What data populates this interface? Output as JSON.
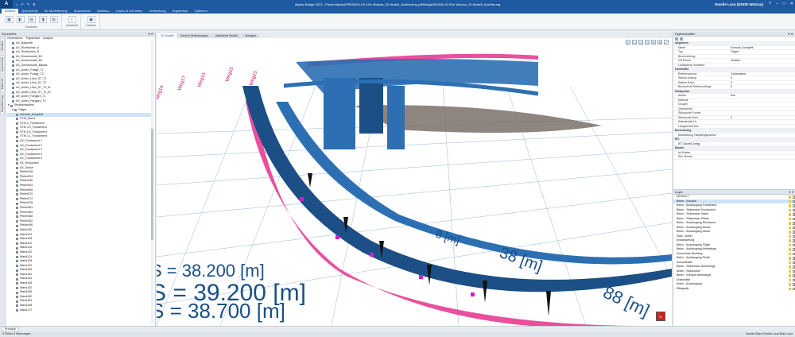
{
  "titlebar": {
    "logo": "A",
    "quick_access": [
      "⌂",
      "↶",
      "↷",
      "⚙"
    ],
    "title": "Allplan Bridge 2022 - Planer/Allplan\\PR0002\\6.U3 KDe Wutzau_20 Modell_Ausführung.ydf\\Bridge\\0002\\6.U3 KDe Wutzau_20 Modell_Ausführung",
    "user": "Davide Luca (DKDE-Wutzau)",
    "controls": [
      "?",
      "–",
      "□",
      "✕"
    ]
  },
  "menu_tabs": [
    "Ansicht",
    "Querschnitt",
    "3D Modellierung",
    "Spannkabel",
    "Stahlbau",
    "Lasten & Einheiten",
    "Verstärkung",
    "Ergebnisse",
    "Optionen"
  ],
  "ribbon": {
    "groups": [
      {
        "label": "Darstellen",
        "buttons": [
          {
            "icon": "▦",
            "label": ""
          },
          {
            "icon": "◧",
            "label": ""
          },
          {
            "icon": "▤",
            "label": ""
          },
          {
            "icon": "◨",
            "label": ""
          },
          {
            "icon": "▧",
            "label": ""
          }
        ]
      },
      {
        "label": "",
        "buttons": [
          {
            "icon": "⇪",
            "label": "Quadrant"
          }
        ]
      },
      {
        "label": "",
        "buttons": [
          {
            "icon": "▣",
            "label": "Löschen"
          }
        ]
      }
    ]
  },
  "left_panel": {
    "title": "Geometrie",
    "tabs": [
      "Generatoren",
      "Ergebnisse",
      "Analyse"
    ],
    "vertical_tabs": [
      "Bauteile",
      "Querschnitt",
      "Materiale",
      "Kabelführung"
    ],
    "tree": [
      {
        "label": "AX_Bauprofil",
        "indent": 1
      },
      {
        "label": "AX_Richtachse_A",
        "indent": 1
      },
      {
        "label": "AX_Richtachse_B",
        "indent": 1
      },
      {
        "label": "AX_Deckenstufe_B1",
        "indent": 1
      },
      {
        "label": "AX_Deckenstufe_B2",
        "indent": 1
      },
      {
        "label": "AX_Deckenstufe_Ballast",
        "indent": 1
      },
      {
        "label": "AX_Anker_Fräsgr_T1",
        "indent": 1
      },
      {
        "label": "AX_Anker_Fräsgr_T2",
        "indent": 1
      },
      {
        "label": "AX_Anker_Litze_S7_T1",
        "indent": 1
      },
      {
        "label": "AX_Anker_Litze_S7_T2",
        "indent": 1
      },
      {
        "label": "AX_Anker_Litze_S7_T1_M",
        "indent": 1
      },
      {
        "label": "AX_Anker_Litze_S7_T2_M",
        "indent": 1
      },
      {
        "label": "AX_Anker_Fangarn_T1",
        "indent": 1
      },
      {
        "label": "AX_Anker_Fangarn_T2",
        "indent": 1
      },
      {
        "label": "Strukturbauteile",
        "indent": 0,
        "expand": "▾"
      },
      {
        "label": "Träger",
        "indent": 1,
        "expand": "▾"
      },
      {
        "label": "Konsole_Komplett",
        "indent": 2,
        "selected": true
      },
      {
        "label": "STM_Wand",
        "indent": 2
      },
      {
        "label": "STM 4_Fundament",
        "indent": 2
      },
      {
        "label": "STM 3.3_Fundament",
        "indent": 2
      },
      {
        "label": "STM 3.5_Fundament",
        "indent": 2
      },
      {
        "label": "STM 3.1_Fundament",
        "indent": 2
      },
      {
        "label": "AX_Fundament 1",
        "indent": 2
      },
      {
        "label": "AX_Fundament 2",
        "indent": 2
      },
      {
        "label": "AX_Fundament 3",
        "indent": 2
      },
      {
        "label": "AX_Fundament 4",
        "indent": 2
      },
      {
        "label": "AX_Fundament 5",
        "indent": 2
      },
      {
        "label": "AX_Rückwand",
        "indent": 2
      },
      {
        "label": "AX_Decke",
        "indent": 2
      },
      {
        "label": "Pfeiler018",
        "indent": 2
      },
      {
        "label": "Pfeiler033",
        "indent": 2
      },
      {
        "label": "Pfeiler048",
        "indent": 2
      },
      {
        "label": "Pfeiler063",
        "indent": 2
      },
      {
        "label": "Pfeiler065",
        "indent": 2
      },
      {
        "label": "Pfeiler070",
        "indent": 2
      },
      {
        "label": "Pfeiler074",
        "indent": 2
      },
      {
        "label": "Pfeiler078",
        "indent": 2
      },
      {
        "label": "Pfeiler081",
        "indent": 2
      },
      {
        "label": "Pfeiler084",
        "indent": 2
      },
      {
        "label": "Pfeiler088",
        "indent": 2
      },
      {
        "label": "Pfeiler092",
        "indent": 2
      },
      {
        "label": "Pfeiler096",
        "indent": 2
      },
      {
        "label": "Wand100",
        "indent": 2
      },
      {
        "label": "Wand104",
        "indent": 2
      },
      {
        "label": "Wand108",
        "indent": 2
      },
      {
        "label": "Wand112",
        "indent": 2
      },
      {
        "label": "Wand116",
        "indent": 2
      },
      {
        "label": "Wand120",
        "indent": 2
      },
      {
        "label": "Wand124",
        "indent": 2
      },
      {
        "label": "Wand128",
        "indent": 2
      },
      {
        "label": "Wand132",
        "indent": 2
      },
      {
        "label": "Wand136",
        "indent": 2
      },
      {
        "label": "Wand140",
        "indent": 2
      },
      {
        "label": "Wand144",
        "indent": 2
      },
      {
        "label": "Wand148",
        "indent": 2
      },
      {
        "label": "Wand152",
        "indent": 2
      },
      {
        "label": "Wand156",
        "indent": 2
      },
      {
        "label": "Wand160",
        "indent": 2
      },
      {
        "label": "Wand164",
        "indent": 2
      },
      {
        "label": "Wand168",
        "indent": 2
      },
      {
        "label": "Wand172",
        "indent": 2
      }
    ]
  },
  "view_tabs": [
    "3D-Modell",
    "Bericht Verbindungen",
    "Statisches Modell",
    "Vorlagen"
  ],
  "viewport": {
    "tools": [
      "◰",
      "◱",
      "◲",
      "◳",
      "⊕",
      "⚙",
      "⤢"
    ],
    "labels": {
      "s1": "S = 39.200 [m]",
      "s2": "S = 38.700 [m]",
      "s3": "S = 38.200 [m]",
      "m1": "38 [m]",
      "m2": "88 [m]",
      "m3": "8 [m]",
      "top1": "Weg16",
      "top2": "Weg17",
      "top3": "Weg13",
      "top4": "Weg15",
      "top5": "Weg23"
    },
    "colors": {
      "bridge": "#2c6fb3",
      "bridge_dark": "#1b4f86",
      "pink": "#ea4f9e",
      "grid": "#9ab8d8",
      "ground": "#7a7068"
    },
    "navcube": "N"
  },
  "properties": {
    "title": "Eigenschaften",
    "rows": [
      {
        "key": "Allgemein",
        "section": true
      },
      {
        "key": "Name",
        "value": "Konsole_Komplett"
      },
      {
        "key": "Typ",
        "value": "Träger"
      },
      {
        "key": "Beschreibung",
        "value": ""
      },
      {
        "key": "GS Ebene",
        "value": "Vertikal"
      },
      {
        "key": "Lokalisierte Varianten",
        "value": ""
      },
      {
        "key": "Geometrie",
        "section": true
      },
      {
        "key": "Referenzachse",
        "value": "Grünerwand"
      },
      {
        "key": "Station Anfang",
        "value": "0"
      },
      {
        "key": "Station Ende",
        "value": "0"
      },
      {
        "key": "Benutzerde Referenzlänge",
        "value": "0"
      },
      {
        "key": "Stützpunkt",
        "section": true
      },
      {
        "key": "Achse",
        "value": "Ace"
      },
      {
        "key": "Material",
        "value": ""
      },
      {
        "key": "Gruppe",
        "value": ""
      },
      {
        "key": "Querschnitt",
        "value": ""
      },
      {
        "key": "Stützpunkt Formel",
        "value": ""
      },
      {
        "key": "Stützpunkt Wert",
        "value": "0"
      },
      {
        "key": "Stabsteinstt Nr.",
        "value": ""
      },
      {
        "key": "Längsschritt Anz.",
        "value": ""
      },
      {
        "key": "Berechnung",
        "section": true
      },
      {
        "key": "Abweichung Hauptträgerachse",
        "value": ""
      },
      {
        "key": "IFC",
        "section": true
      },
      {
        "key": "IFC Bauteil-Anfgg",
        "value": ""
      },
      {
        "key": "Muster",
        "section": true
      },
      {
        "key": "Ist Muster",
        "value": ""
      },
      {
        "key": "Ref. Muster",
        "value": ""
      }
    ]
  },
  "layers": {
    "title": "Layer",
    "items": [
      {
        "label": "DEFAULT"
      },
      {
        "label": "Beton - Konsole",
        "selected": true
      },
      {
        "label": "Beton - Ausbaugang Fundament"
      },
      {
        "label": "Beton - Stützmauer Fundament"
      },
      {
        "label": "Beton - Stützmauer Wand"
      },
      {
        "label": "Beton - Stützmauer Pfeiler"
      },
      {
        "label": "Beton - Ausbaugang Rückwand"
      },
      {
        "label": "Beton - Ausbaugang Decke"
      },
      {
        "label": "Beton - Ausbaugang Wand"
      },
      {
        "label": "Stahl - Anker"
      },
      {
        "label": "Entwässerung"
      },
      {
        "label": "Beton - Ausbaugang Flügel"
      },
      {
        "label": "Beton - Ausbaugang Arbeitsfuge"
      },
      {
        "label": "Horizontale Bewehrg."
      },
      {
        "label": "Beton - Ausbaugang Pfeiler"
      },
      {
        "label": "Konsolankter"
      },
      {
        "label": "Beton - Stützmauer Arbeitsfuge"
      },
      {
        "label": "Anker - Stützmauer"
      },
      {
        "label": "Beton - Konsole Arbeitsfuge"
      },
      {
        "label": "Drainmatte"
      },
      {
        "label": "Anker - Ausbaugang"
      },
      {
        "label": "Hilfsgrafik"
      }
    ]
  },
  "bottom_tab": "Protokoll",
  "status": {
    "left": "0 Fehler 0 Warnungen",
    "right": "Davide Bianx Davidc Luca Bian Luca"
  }
}
